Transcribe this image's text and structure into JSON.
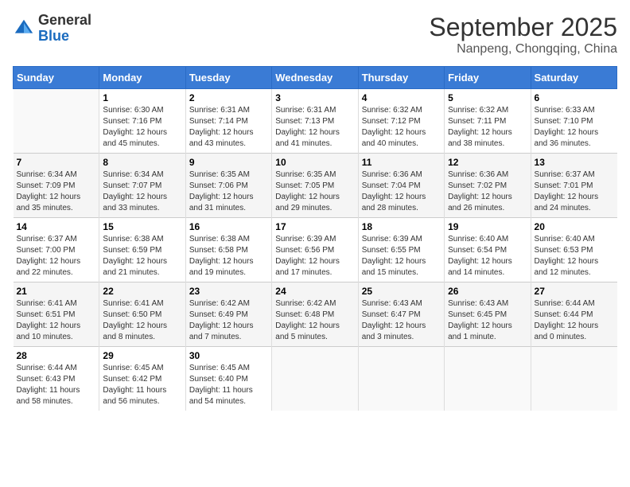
{
  "header": {
    "logo_general": "General",
    "logo_blue": "Blue",
    "month": "September 2025",
    "location": "Nanpeng, Chongqing, China"
  },
  "calendar": {
    "weekdays": [
      "Sunday",
      "Monday",
      "Tuesday",
      "Wednesday",
      "Thursday",
      "Friday",
      "Saturday"
    ],
    "weeks": [
      [
        {
          "day": "",
          "info": ""
        },
        {
          "day": "1",
          "info": "Sunrise: 6:30 AM\nSunset: 7:16 PM\nDaylight: 12 hours\nand 45 minutes."
        },
        {
          "day": "2",
          "info": "Sunrise: 6:31 AM\nSunset: 7:14 PM\nDaylight: 12 hours\nand 43 minutes."
        },
        {
          "day": "3",
          "info": "Sunrise: 6:31 AM\nSunset: 7:13 PM\nDaylight: 12 hours\nand 41 minutes."
        },
        {
          "day": "4",
          "info": "Sunrise: 6:32 AM\nSunset: 7:12 PM\nDaylight: 12 hours\nand 40 minutes."
        },
        {
          "day": "5",
          "info": "Sunrise: 6:32 AM\nSunset: 7:11 PM\nDaylight: 12 hours\nand 38 minutes."
        },
        {
          "day": "6",
          "info": "Sunrise: 6:33 AM\nSunset: 7:10 PM\nDaylight: 12 hours\nand 36 minutes."
        }
      ],
      [
        {
          "day": "7",
          "info": "Sunrise: 6:34 AM\nSunset: 7:09 PM\nDaylight: 12 hours\nand 35 minutes."
        },
        {
          "day": "8",
          "info": "Sunrise: 6:34 AM\nSunset: 7:07 PM\nDaylight: 12 hours\nand 33 minutes."
        },
        {
          "day": "9",
          "info": "Sunrise: 6:35 AM\nSunset: 7:06 PM\nDaylight: 12 hours\nand 31 minutes."
        },
        {
          "day": "10",
          "info": "Sunrise: 6:35 AM\nSunset: 7:05 PM\nDaylight: 12 hours\nand 29 minutes."
        },
        {
          "day": "11",
          "info": "Sunrise: 6:36 AM\nSunset: 7:04 PM\nDaylight: 12 hours\nand 28 minutes."
        },
        {
          "day": "12",
          "info": "Sunrise: 6:36 AM\nSunset: 7:02 PM\nDaylight: 12 hours\nand 26 minutes."
        },
        {
          "day": "13",
          "info": "Sunrise: 6:37 AM\nSunset: 7:01 PM\nDaylight: 12 hours\nand 24 minutes."
        }
      ],
      [
        {
          "day": "14",
          "info": "Sunrise: 6:37 AM\nSunset: 7:00 PM\nDaylight: 12 hours\nand 22 minutes."
        },
        {
          "day": "15",
          "info": "Sunrise: 6:38 AM\nSunset: 6:59 PM\nDaylight: 12 hours\nand 21 minutes."
        },
        {
          "day": "16",
          "info": "Sunrise: 6:38 AM\nSunset: 6:58 PM\nDaylight: 12 hours\nand 19 minutes."
        },
        {
          "day": "17",
          "info": "Sunrise: 6:39 AM\nSunset: 6:56 PM\nDaylight: 12 hours\nand 17 minutes."
        },
        {
          "day": "18",
          "info": "Sunrise: 6:39 AM\nSunset: 6:55 PM\nDaylight: 12 hours\nand 15 minutes."
        },
        {
          "day": "19",
          "info": "Sunrise: 6:40 AM\nSunset: 6:54 PM\nDaylight: 12 hours\nand 14 minutes."
        },
        {
          "day": "20",
          "info": "Sunrise: 6:40 AM\nSunset: 6:53 PM\nDaylight: 12 hours\nand 12 minutes."
        }
      ],
      [
        {
          "day": "21",
          "info": "Sunrise: 6:41 AM\nSunset: 6:51 PM\nDaylight: 12 hours\nand 10 minutes."
        },
        {
          "day": "22",
          "info": "Sunrise: 6:41 AM\nSunset: 6:50 PM\nDaylight: 12 hours\nand 8 minutes."
        },
        {
          "day": "23",
          "info": "Sunrise: 6:42 AM\nSunset: 6:49 PM\nDaylight: 12 hours\nand 7 minutes."
        },
        {
          "day": "24",
          "info": "Sunrise: 6:42 AM\nSunset: 6:48 PM\nDaylight: 12 hours\nand 5 minutes."
        },
        {
          "day": "25",
          "info": "Sunrise: 6:43 AM\nSunset: 6:47 PM\nDaylight: 12 hours\nand 3 minutes."
        },
        {
          "day": "26",
          "info": "Sunrise: 6:43 AM\nSunset: 6:45 PM\nDaylight: 12 hours\nand 1 minute."
        },
        {
          "day": "27",
          "info": "Sunrise: 6:44 AM\nSunset: 6:44 PM\nDaylight: 12 hours\nand 0 minutes."
        }
      ],
      [
        {
          "day": "28",
          "info": "Sunrise: 6:44 AM\nSunset: 6:43 PM\nDaylight: 11 hours\nand 58 minutes."
        },
        {
          "day": "29",
          "info": "Sunrise: 6:45 AM\nSunset: 6:42 PM\nDaylight: 11 hours\nand 56 minutes."
        },
        {
          "day": "30",
          "info": "Sunrise: 6:45 AM\nSunset: 6:40 PM\nDaylight: 11 hours\nand 54 minutes."
        },
        {
          "day": "",
          "info": ""
        },
        {
          "day": "",
          "info": ""
        },
        {
          "day": "",
          "info": ""
        },
        {
          "day": "",
          "info": ""
        }
      ]
    ]
  }
}
